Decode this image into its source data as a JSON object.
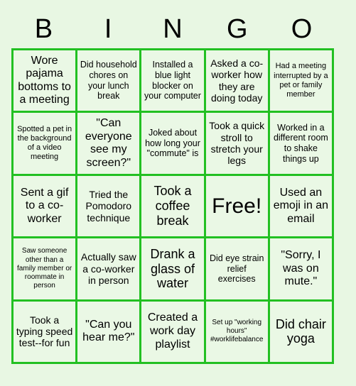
{
  "card": {
    "title": "BINGO",
    "background_color": "#e8f7e3",
    "border_color": "#22c022",
    "cell_color": "#eaf8e5",
    "text_color": "#000000",
    "columns": 5,
    "rows": 5
  },
  "header": {
    "letters": [
      "B",
      "I",
      "N",
      "G",
      "O"
    ]
  },
  "cells": [
    {
      "text": "Wore pajama bottoms to a meeting",
      "size": "l"
    },
    {
      "text": "Did household chores on your lunch break",
      "size": "s"
    },
    {
      "text": "Installed a blue light blocker on your computer",
      "size": "s"
    },
    {
      "text": "Asked a co-worker how they are doing today",
      "size": "m"
    },
    {
      "text": "Had a meeting interrupted by a pet or family member",
      "size": "xs"
    },
    {
      "text": "Spotted a pet in the background of a video meeting",
      "size": "xs"
    },
    {
      "text": "\"Can everyone see my screen?\"",
      "size": "l"
    },
    {
      "text": "Joked about how long your \"commute\" is",
      "size": "s"
    },
    {
      "text": "Took a quick stroll to stretch your legs",
      "size": "m"
    },
    {
      "text": "Worked in a different room to shake things up",
      "size": "s"
    },
    {
      "text": "Sent a gif to a co-worker",
      "size": "l"
    },
    {
      "text": "Tried the Pomodoro technique",
      "size": "m"
    },
    {
      "text": "Took a coffee break",
      "size": "xl"
    },
    {
      "text": "Free!",
      "size": "free"
    },
    {
      "text": "Used an emoji in an email",
      "size": "l"
    },
    {
      "text": "Saw someone other than a family member or roommate in person",
      "size": "xxs"
    },
    {
      "text": "Actually saw a co-worker in person",
      "size": "m"
    },
    {
      "text": "Drank a glass of water",
      "size": "xl"
    },
    {
      "text": "Did eye strain relief exercises",
      "size": "s"
    },
    {
      "text": "\"Sorry, I was on mute.\"",
      "size": "l"
    },
    {
      "text": "Took a typing speed test--for fun",
      "size": "m"
    },
    {
      "text": "\"Can you hear me?\"",
      "size": "l"
    },
    {
      "text": "Created a work day playlist",
      "size": "l"
    },
    {
      "text": "Set up \"working hours\" #worklifebalance",
      "size": "xxs"
    },
    {
      "text": "Did chair yoga",
      "size": "xl"
    }
  ]
}
